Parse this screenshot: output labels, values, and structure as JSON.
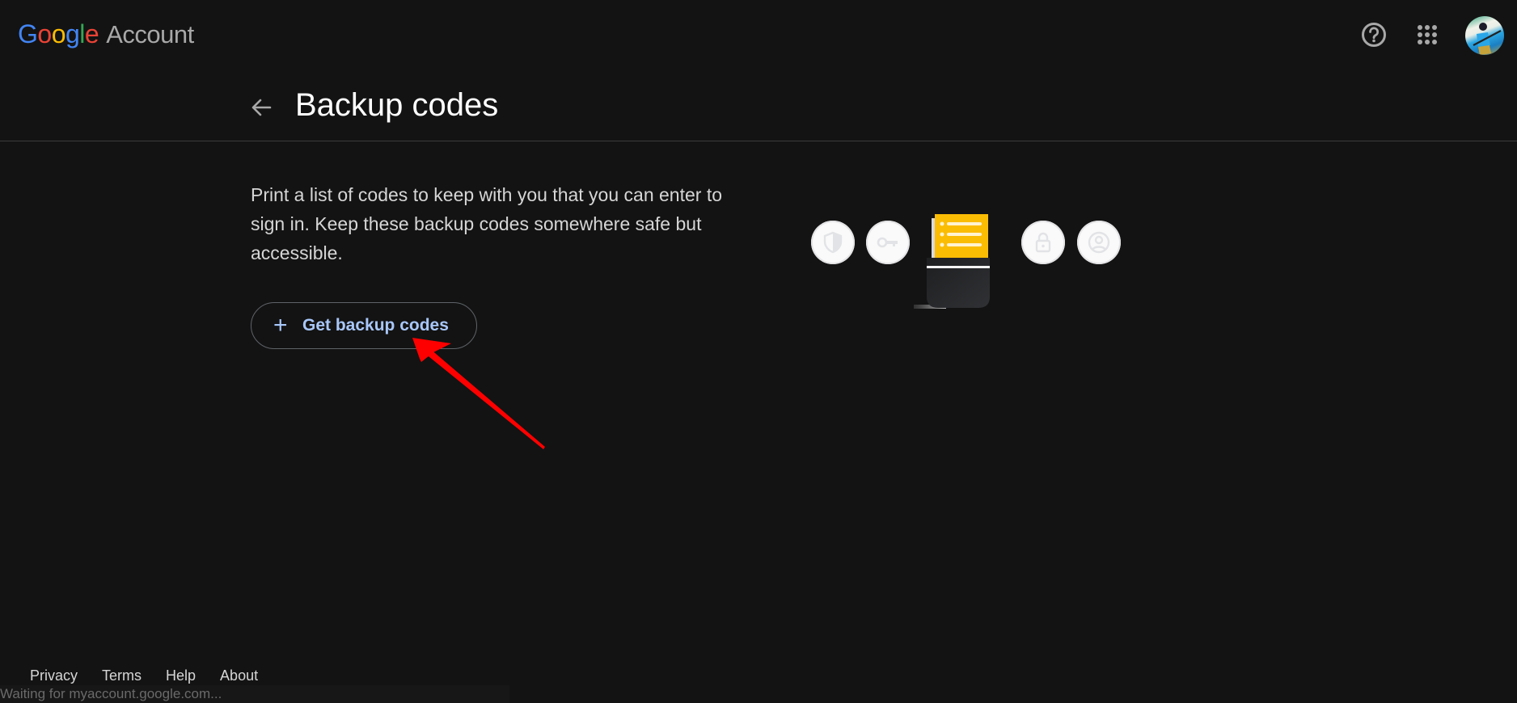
{
  "header": {
    "logo_letters": [
      "G",
      "o",
      "o",
      "g",
      "l",
      "e"
    ],
    "product_name": "Account",
    "help_icon": "help-circle-icon",
    "apps_icon": "apps-grid-icon",
    "avatar_alt": "Account avatar"
  },
  "page": {
    "back_icon": "arrow-left-icon",
    "title": "Backup codes",
    "description": "Print a list of codes to keep with you that you can enter to sign in. Keep these backup codes somewhere safe but accessible.",
    "get_codes_button": {
      "icon": "plus-icon",
      "icon_glyph": "+",
      "label": "Get backup codes"
    }
  },
  "illustration": {
    "icons": [
      "shield-icon",
      "key-icon",
      "backup-codes-card",
      "lock-icon",
      "person-icon"
    ],
    "card_color": "#fbbc04"
  },
  "annotation": {
    "type": "red-arrow",
    "color": "#ff0000",
    "points_to": "get-backup-codes-button"
  },
  "footer": {
    "links": [
      "Privacy",
      "Terms",
      "Help",
      "About"
    ]
  },
  "status_bar": {
    "text": "Waiting for myaccount.google.com..."
  },
  "colors": {
    "background": "#131313",
    "accent_text": "#a8c7fa",
    "title_text": "#ffffff"
  }
}
